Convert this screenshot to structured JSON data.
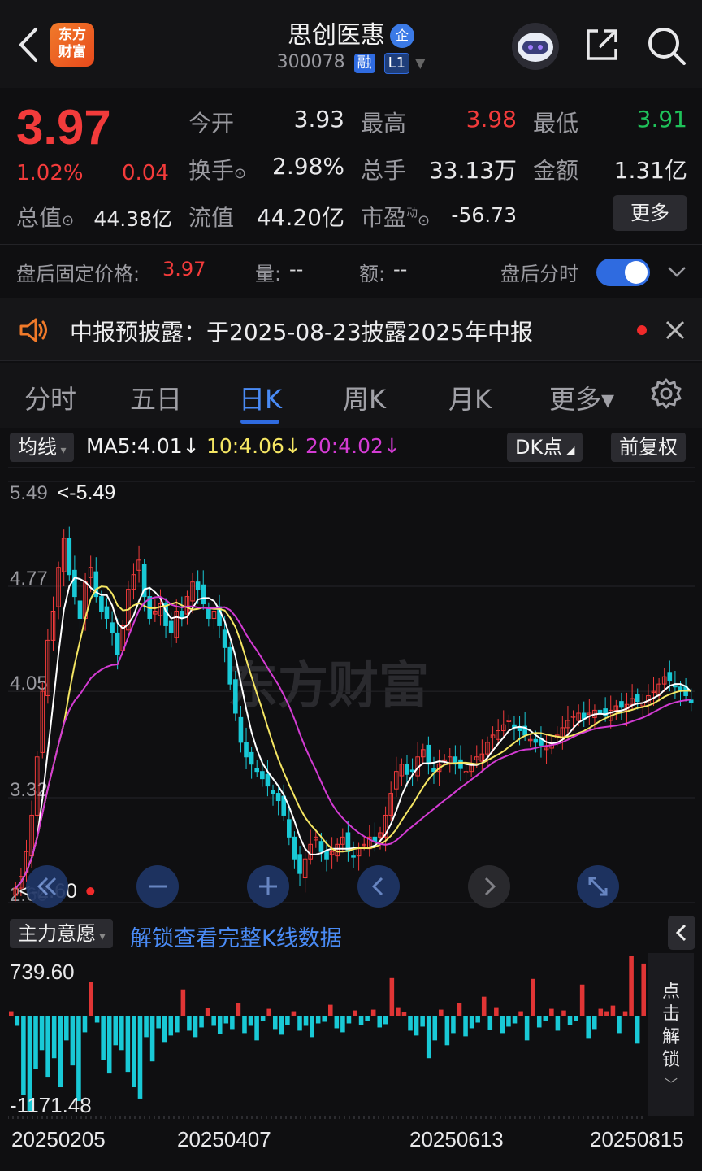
{
  "header": {
    "logo_text": "东方财富",
    "stock_name": "思创医惠",
    "enterprise_badge": "企",
    "stock_code": "300078",
    "tag_margin": "融",
    "tag_level": "L1",
    "icons": [
      "back-icon",
      "assistant-robot-icon",
      "share-icon",
      "search-icon"
    ]
  },
  "quote": {
    "price": "3.97",
    "change_pct": "1.02%",
    "change_amt": "0.04",
    "fields": {
      "open_label": "今开",
      "open": "3.93",
      "high_label": "最高",
      "high": "3.98",
      "low_label": "最低",
      "low": "3.91",
      "turnover_label": "换手",
      "turnover": "2.98%",
      "volume_label": "总手",
      "volume": "33.13万",
      "amount_label": "金额",
      "amount": "1.31亿",
      "mktcap_label": "总值",
      "mktcap": "44.38亿",
      "float_label": "流值",
      "float": "44.20亿",
      "pe_label": "市盈",
      "pe_sup": "动",
      "pe": "-56.73"
    },
    "more_label": "更多"
  },
  "after_hours": {
    "price_label": "盘后固定价格:",
    "price": "3.97",
    "vol_label": "量:",
    "vol": "--",
    "amt_label": "额:",
    "amt": "--",
    "switch_label": "盘后分时",
    "switch_on": true
  },
  "notice": {
    "text": "中报预披露：于2025-08-23披露2025年中报"
  },
  "tabs": [
    "分时",
    "五日",
    "日K",
    "周K",
    "月K",
    "更多▾"
  ],
  "active_tab": "日K",
  "ma_bar": {
    "type_label": "均线",
    "ma5": "MA5:4.01↓",
    "ma10": "10:4.06↓",
    "ma20": "20:4.02↓",
    "dk_label": "DK点",
    "adjust_label": "前复权"
  },
  "chart_data": [
    {
      "type": "candlestick",
      "yaxis_ticks": [
        "5.49",
        "4.77",
        "4.05",
        "3.32",
        "2.60"
      ],
      "ylim": [
        2.6,
        5.49
      ],
      "annotations": [
        "<-5.49",
        "<-2.60"
      ],
      "series_colors": {
        "up": "#f23b3b",
        "down": "#19c9d6",
        "ma5": "#ffffff",
        "ma10": "#f5e663",
        "ma20": "#d33bd3"
      },
      "watermark": "东方财富",
      "close": [
        2.7,
        2.78,
        2.95,
        3.2,
        3.6,
        4.05,
        4.4,
        4.6,
        4.9,
        5.1,
        4.85,
        4.7,
        4.55,
        4.8,
        4.9,
        4.7,
        4.6,
        4.55,
        4.45,
        4.3,
        4.5,
        4.75,
        4.85,
        4.95,
        4.7,
        4.55,
        4.6,
        4.65,
        4.5,
        4.45,
        4.6,
        4.55,
        4.7,
        4.8,
        4.75,
        4.65,
        4.55,
        4.6,
        4.5,
        4.35,
        4.1,
        3.9,
        3.7,
        3.6,
        3.55,
        3.5,
        3.45,
        3.4,
        3.35,
        3.3,
        3.2,
        3.05,
        2.9,
        2.8,
        2.9,
        3.0,
        3.05,
        2.95,
        2.9,
        2.95,
        3.0,
        3.05,
        2.95,
        2.92,
        2.97,
        3.0,
        3.05,
        3.02,
        3.08,
        3.2,
        3.35,
        3.5,
        3.55,
        3.48,
        3.5,
        3.6,
        3.65,
        3.55,
        3.5,
        3.55,
        3.58,
        3.6,
        3.55,
        3.52,
        3.5,
        3.55,
        3.6,
        3.62,
        3.7,
        3.75,
        3.78,
        3.82,
        3.85,
        3.8,
        3.78,
        3.75,
        3.72,
        3.7,
        3.68,
        3.66,
        3.7,
        3.75,
        3.8,
        3.85,
        3.88,
        3.9,
        3.86,
        3.9,
        3.92,
        3.9,
        3.88,
        3.92,
        3.95,
        3.94,
        3.96,
        4.0,
        3.98,
        3.97,
        4.02,
        4.05,
        4.1,
        4.15,
        4.12,
        4.08,
        4.05,
        4.02,
        3.97
      ]
    },
    {
      "type": "bar",
      "title": "主力意愿",
      "note": "解锁查看完整K线数据",
      "yaxis_ticks": [
        "739.60",
        "-1171.48"
      ],
      "ylim": [
        -1171.48,
        739.6
      ],
      "x_labels": [
        "20250205",
        "20250407",
        "20250613",
        "20250815"
      ],
      "values": [
        60,
        -120,
        -980,
        -1171,
        -650,
        -420,
        -760,
        -520,
        -880,
        -300,
        -610,
        -1050,
        -200,
        420,
        -80,
        -540,
        -710,
        -360,
        -420,
        -690,
        -880,
        -1020,
        -260,
        -560,
        -150,
        -320,
        -240,
        -200,
        330,
        -180,
        -260,
        -140,
        100,
        -120,
        -220,
        -90,
        -160,
        160,
        -210,
        -120,
        -300,
        -60,
        90,
        -160,
        -230,
        -110,
        60,
        -180,
        -120,
        -260,
        -90,
        -70,
        140,
        -150,
        -200,
        -90,
        70,
        -110,
        -60,
        80,
        -140,
        -100,
        470,
        110,
        50,
        -180,
        -240,
        -130,
        -520,
        -300,
        80,
        -360,
        -210,
        160,
        -250,
        -150,
        -80,
        240,
        -170,
        110,
        -210,
        -130,
        -90,
        60,
        -300,
        460,
        -140,
        -60,
        90,
        -180,
        70,
        -110,
        -60,
        390,
        -280,
        -160,
        90,
        60,
        130,
        -210,
        60,
        740,
        -340,
        650
      ]
    }
  ],
  "sub_chart": {
    "unlock_side_label": "点击解锁"
  },
  "controls": [
    "rewind-icon",
    "zoom-out-icon",
    "zoom-in-icon",
    "prev-icon",
    "next-icon",
    "fullscreen-icon"
  ]
}
